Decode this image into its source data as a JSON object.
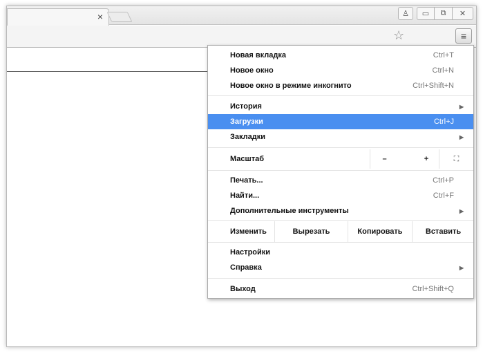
{
  "window": {
    "tab_close": "×",
    "controls": {
      "profile": "♙",
      "minimize": "▭",
      "maximize": "⧉",
      "close": "✕"
    }
  },
  "toolbar": {
    "star_icon": "☆",
    "menu_icon": "≡"
  },
  "menu": {
    "new_tab": {
      "label": "Новая вкладка",
      "shortcut": "Ctrl+T"
    },
    "new_window": {
      "label": "Новое окно",
      "shortcut": "Ctrl+N"
    },
    "incognito": {
      "label": "Новое окно в режиме инкогнито",
      "shortcut": "Ctrl+Shift+N"
    },
    "history": {
      "label": "История",
      "arrow": "▶"
    },
    "downloads": {
      "label": "Загрузки",
      "shortcut": "Ctrl+J"
    },
    "bookmarks": {
      "label": "Закладки",
      "arrow": "▶"
    },
    "zoom": {
      "label": "Масштаб",
      "minus": "–",
      "value": "",
      "plus": "+",
      "fullscreen": "⛶"
    },
    "print": {
      "label": "Печать...",
      "shortcut": "Ctrl+P"
    },
    "find": {
      "label": "Найти...",
      "shortcut": "Ctrl+F"
    },
    "more_tools": {
      "label": "Дополнительные инструменты",
      "arrow": "▶"
    },
    "edit": {
      "label": "Изменить",
      "cut": "Вырезать",
      "copy": "Копировать",
      "paste": "Вставить"
    },
    "settings": {
      "label": "Настройки"
    },
    "help": {
      "label": "Справка",
      "arrow": "▶"
    },
    "exit": {
      "label": "Выход",
      "shortcut": "Ctrl+Shift+Q"
    }
  },
  "colors": {
    "highlight": "#4a8ff0"
  }
}
